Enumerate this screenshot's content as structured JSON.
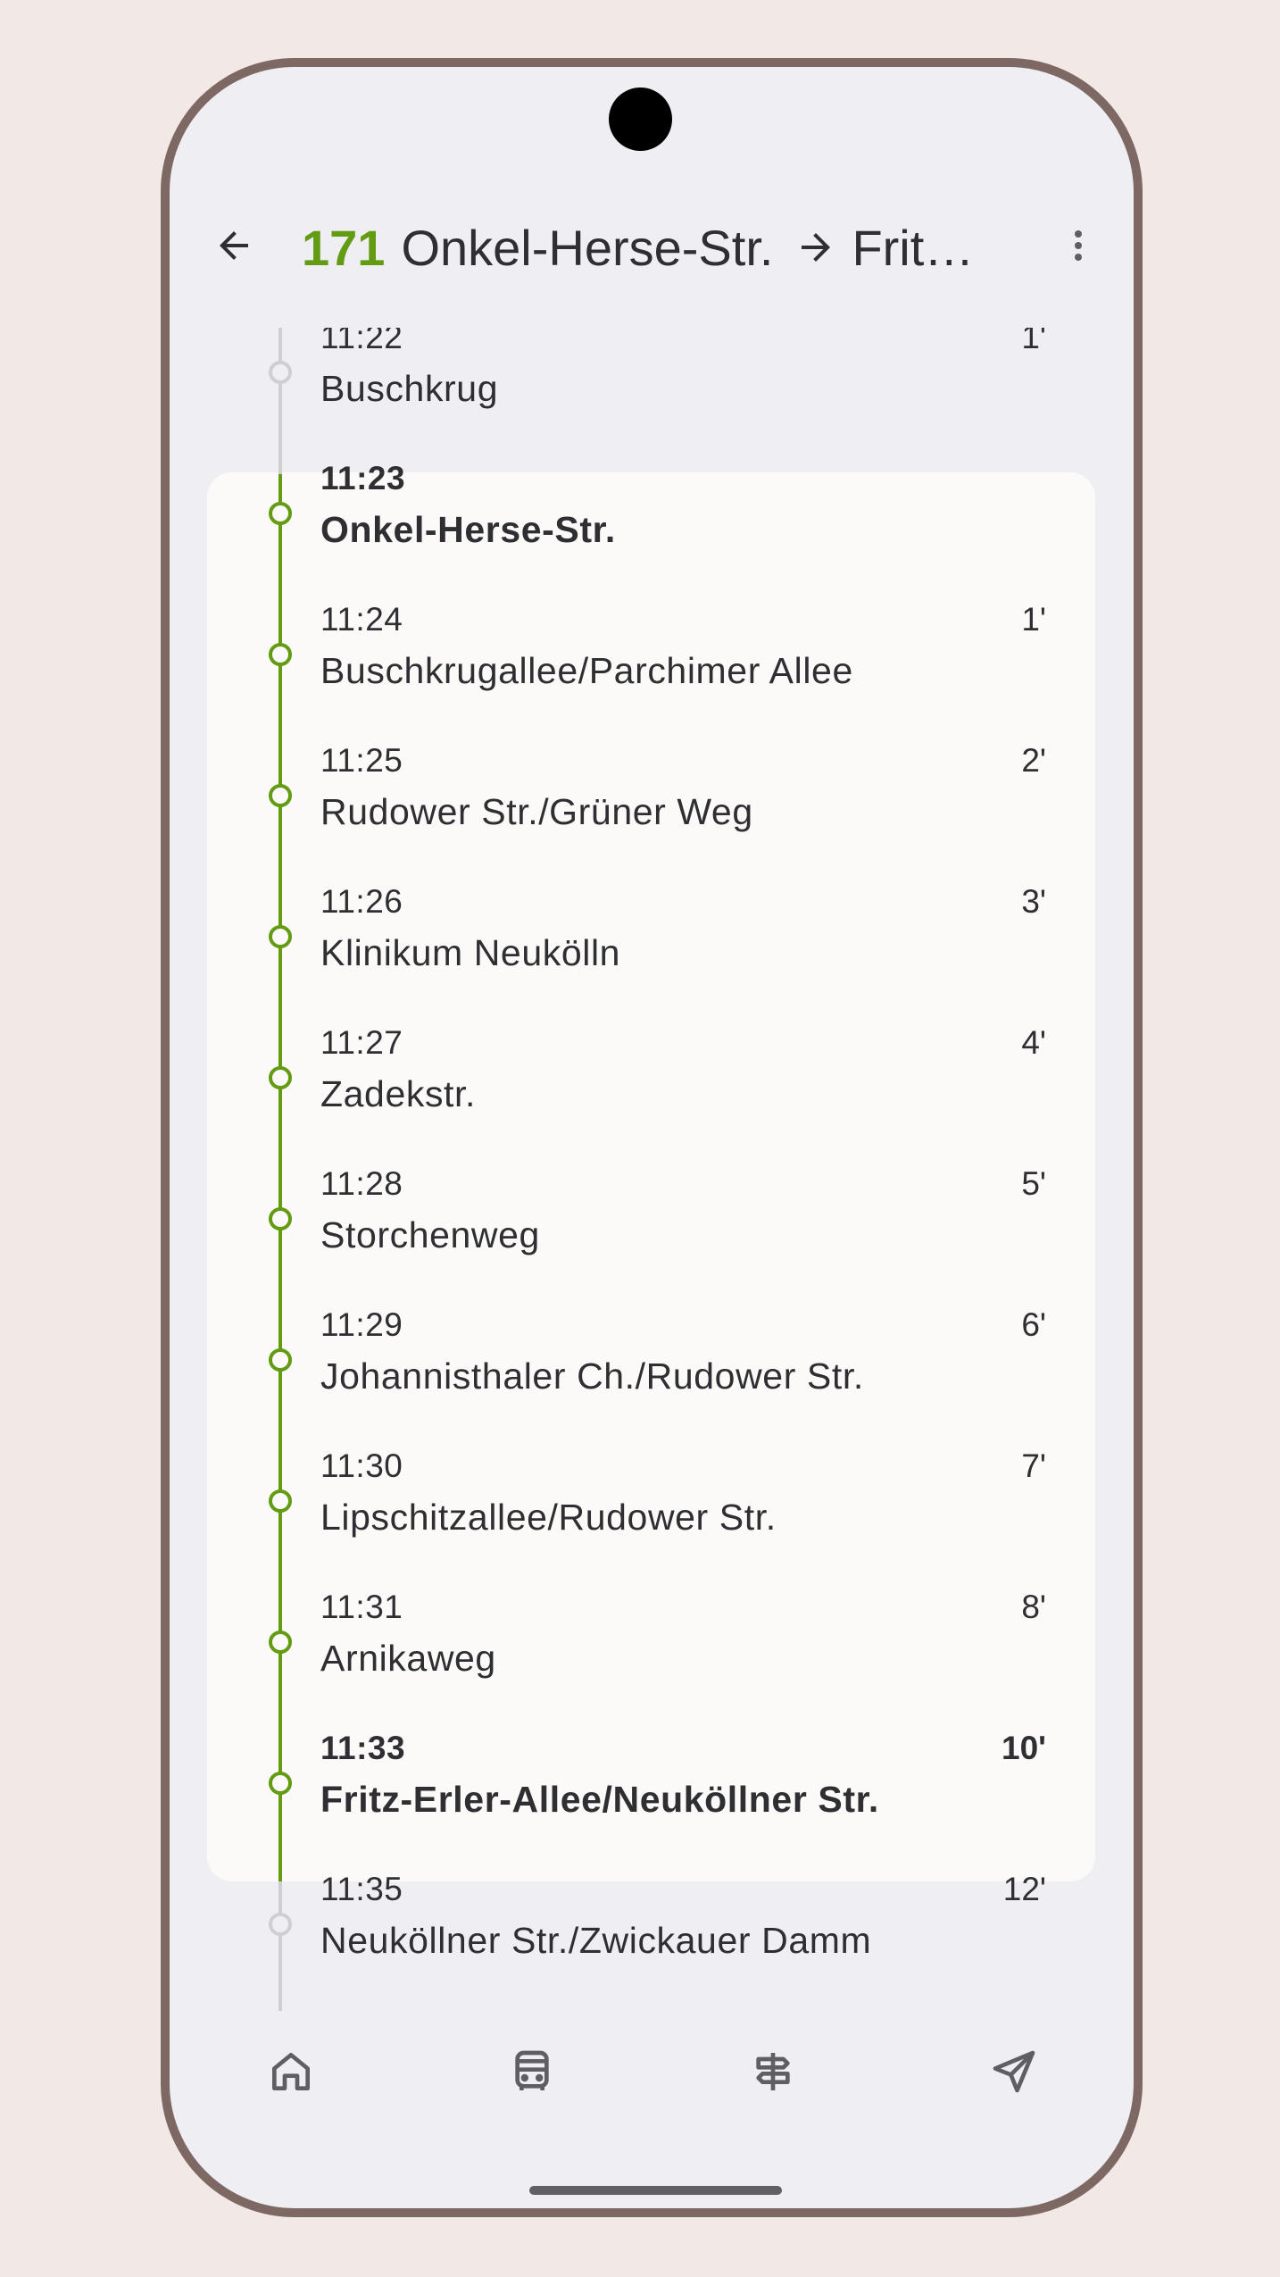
{
  "header": {
    "line_number": "171",
    "origin": "Onkel-Herse-Str.",
    "destination": "Fritz-...",
    "back_icon": "arrow-back-icon",
    "direction_icon": "arrow-right-icon",
    "menu_icon": "more-vert-icon"
  },
  "colors": {
    "line_accent": "#639b13",
    "inactive_track": "#cfcfd1",
    "card_background": "#fbfaf9",
    "screen_background": "#efeef2",
    "frame": "#7d6864"
  },
  "stops": [
    {
      "time": "11:22",
      "name": "Buschkrug",
      "offset": "1'",
      "state": "before",
      "emphasis": false
    },
    {
      "time": "11:23",
      "name": "Onkel-Herse-Str.",
      "offset": "",
      "state": "on-route",
      "emphasis": true
    },
    {
      "time": "11:24",
      "name": "Buschkrugallee/Parchimer Allee",
      "offset": "1'",
      "state": "on-route",
      "emphasis": false
    },
    {
      "time": "11:25",
      "name": "Rudower Str./Grüner Weg",
      "offset": "2'",
      "state": "on-route",
      "emphasis": false
    },
    {
      "time": "11:26",
      "name": "Klinikum Neukölln",
      "offset": "3'",
      "state": "on-route",
      "emphasis": false
    },
    {
      "time": "11:27",
      "name": "Zadekstr.",
      "offset": "4'",
      "state": "on-route",
      "emphasis": false
    },
    {
      "time": "11:28",
      "name": "Storchenweg",
      "offset": "5'",
      "state": "on-route",
      "emphasis": false
    },
    {
      "time": "11:29",
      "name": "Johannisthaler Ch./Rudower Str.",
      "offset": "6'",
      "state": "on-route",
      "emphasis": false
    },
    {
      "time": "11:30",
      "name": "Lipschitzallee/Rudower Str.",
      "offset": "7'",
      "state": "on-route",
      "emphasis": false
    },
    {
      "time": "11:31",
      "name": "Arnikaweg",
      "offset": "8'",
      "state": "on-route",
      "emphasis": false
    },
    {
      "time": "11:33",
      "name": "Fritz-Erler-Allee/Neuköllner Str.",
      "offset": "10'",
      "state": "on-route",
      "emphasis": true
    },
    {
      "time": "11:35",
      "name": "Neuköllner Str./Zwickauer Damm",
      "offset": "12'",
      "state": "after",
      "emphasis": false
    }
  ],
  "bottom_nav": [
    {
      "icon": "home-icon"
    },
    {
      "icon": "bus-icon"
    },
    {
      "icon": "signpost-icon"
    },
    {
      "icon": "navigation-icon"
    }
  ]
}
